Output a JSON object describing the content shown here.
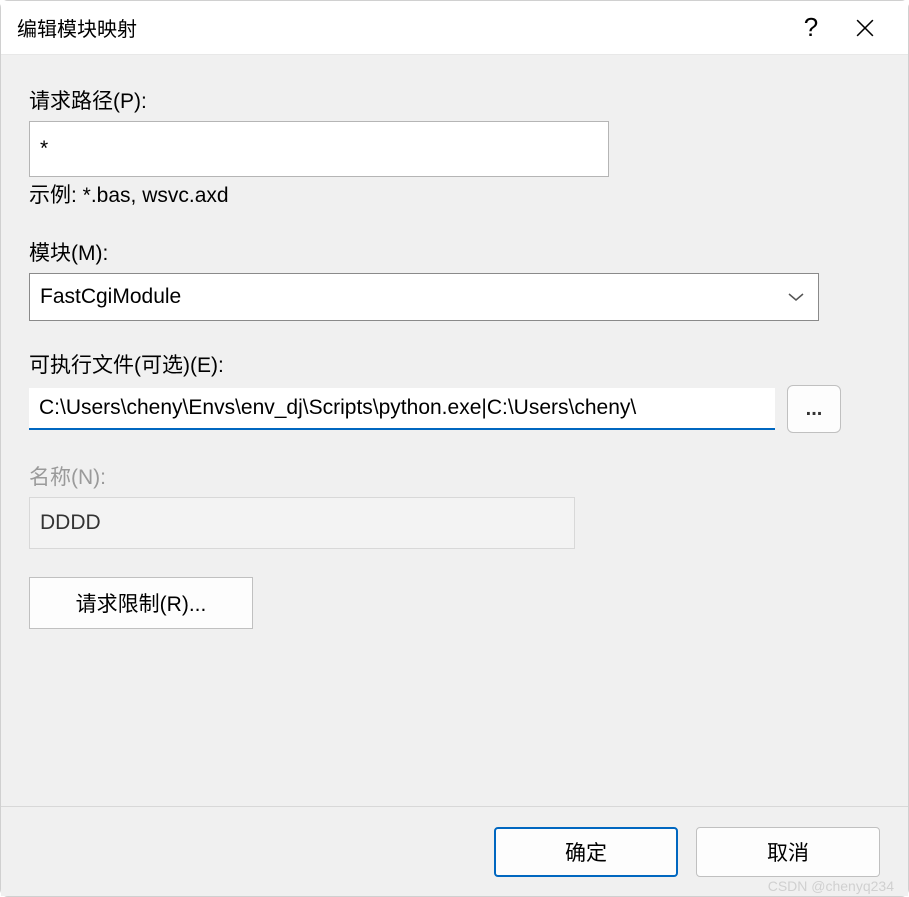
{
  "dialog": {
    "title": "编辑模块映射"
  },
  "fields": {
    "requestPath": {
      "label": "请求路径(P):",
      "value": "*",
      "hint": "示例: *.bas, wsvc.axd"
    },
    "module": {
      "label": "模块(M):",
      "value": "FastCgiModule"
    },
    "executable": {
      "label": "可执行文件(可选)(E):",
      "value": "C:\\Users\\cheny\\Envs\\env_dj\\Scripts\\python.exe|C:\\Users\\cheny\\",
      "browseLabel": "..."
    },
    "name": {
      "label": "名称(N):",
      "value": "DDDD"
    }
  },
  "buttons": {
    "requestLimit": "请求限制(R)...",
    "ok": "确定",
    "cancel": "取消"
  },
  "watermark": "CSDN @chenyq234"
}
